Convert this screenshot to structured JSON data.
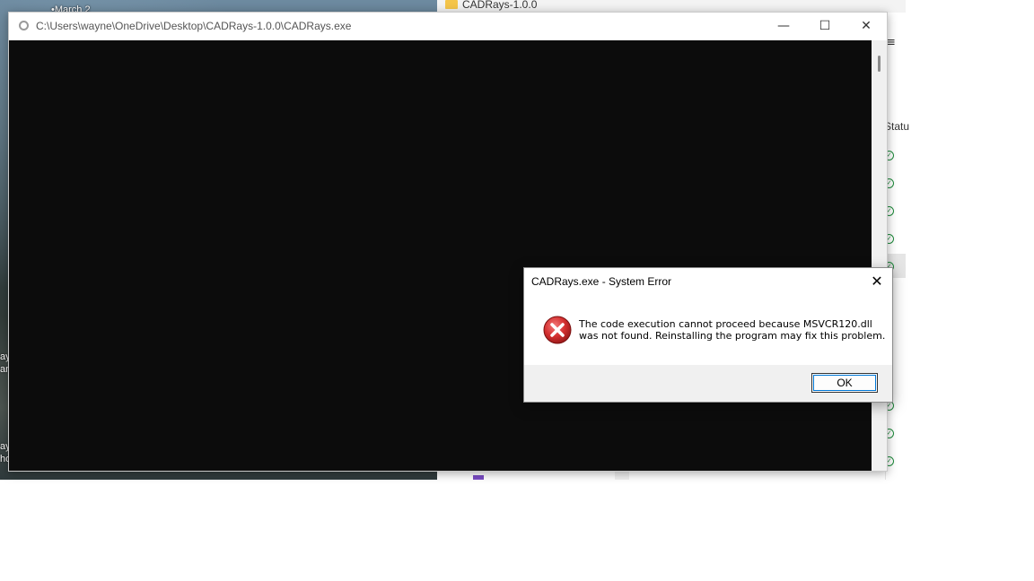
{
  "desktop": {
    "icon_labels": [
      "•March 2",
      "ay",
      "an",
      "ay",
      "ho"
    ]
  },
  "explorer": {
    "folder_label": "CADRays-1.0.0",
    "status_header": "Statu",
    "hamburger": "≡"
  },
  "console": {
    "title": "C:\\Users\\wayne\\OneDrive\\Desktop\\CADRays-1.0.0\\CADRays.exe",
    "minimize": "—",
    "maximize": "☐",
    "close": "✕"
  },
  "dialog": {
    "title": "CADRays.exe - System Error",
    "close": "✕",
    "message_line1": "The code execution cannot proceed because MSVCR120.dll",
    "message_line2": "was not found. Reinstalling the program may fix this problem.",
    "ok_label": "OK",
    "icon": "error-icon",
    "icon_color": "#d32f2f"
  }
}
